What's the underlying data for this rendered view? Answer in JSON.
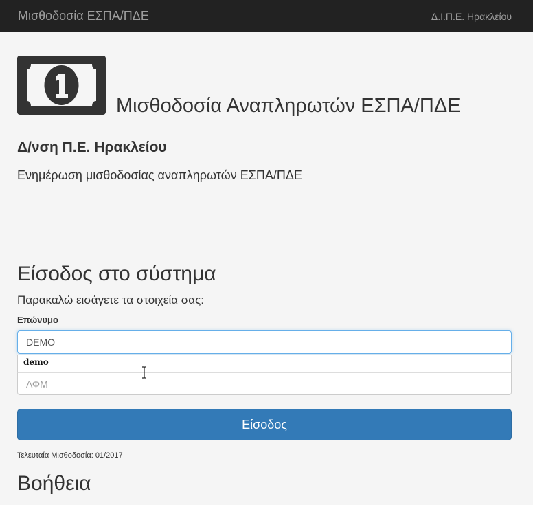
{
  "navbar": {
    "brand": "Μισθοδοσία ΕΣΠΑ/ΠΔΕ",
    "right_link": "Δ.Ι.Π.Ε. Ηρακλείου"
  },
  "hero": {
    "icon": "money-bill-icon",
    "title": "Μισθοδοσία Αναπληρωτών ΕΣΠΑ/ΠΔΕ"
  },
  "subtitle": "Δ/νση Π.Ε. Ηρακλείου",
  "description": "Ενημέρωση μισθοδοσίας αναπληρωτών ΕΣΠΑ/ΠΔΕ",
  "login": {
    "title": "Είσοδος στο σύστημα",
    "prompt": "Παρακαλώ εισάγετε τα στοιχεία σας:",
    "surname_label": "Επώνυμο",
    "surname_value": "DEMO",
    "autocomplete_suggestion": "demo",
    "afm_placeholder": "ΑΦΜ",
    "submit_label": "Είσοδος",
    "last_payroll": "Τελευταία Μισθοδοσία: 01/2017"
  },
  "help": {
    "title": "Βοήθεια"
  }
}
